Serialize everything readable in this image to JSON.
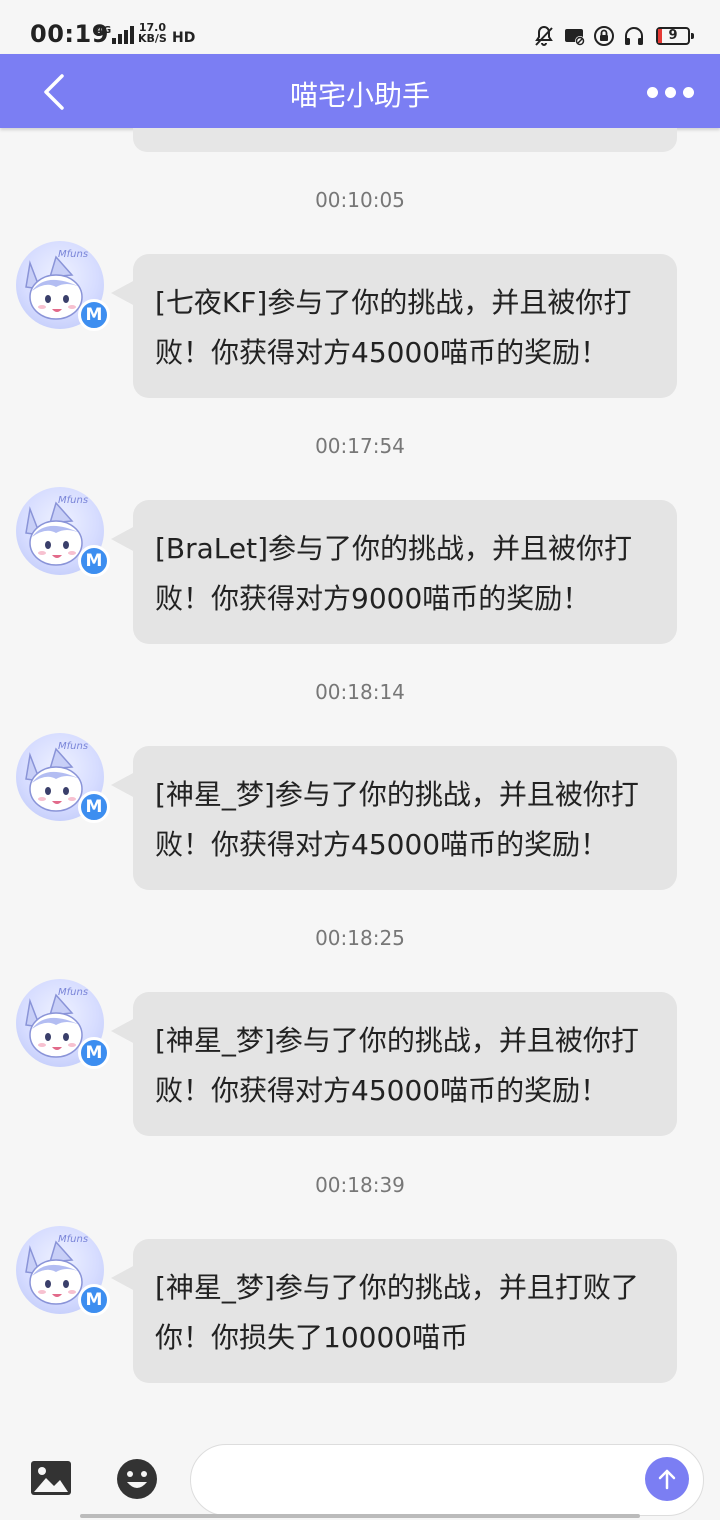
{
  "status_bar": {
    "time": "00:19",
    "network": "4G",
    "speed_value": "17.0",
    "speed_unit": "KB/S",
    "hd": "HD",
    "battery_level": "9",
    "icons": [
      "mute-icon",
      "cast-icon",
      "vpn-lock-icon",
      "headphones-icon"
    ]
  },
  "header": {
    "title": "喵宅小助手",
    "back_icon": "chevron-left-icon",
    "more_icon": "more-dots-icon"
  },
  "messages": [
    {
      "time": "00:10:05",
      "text": "[七夜KF]参与了你的挑战，并且被你打败！你获得对方45000喵币的奖励！"
    },
    {
      "time": "00:17:54",
      "text": "[BraLet]参与了你的挑战，并且被你打败！你获得对方9000喵币的奖励！"
    },
    {
      "time": "00:18:14",
      "text": "[神星_梦]参与了你的挑战，并且被你打败！你获得对方45000喵币的奖励！"
    },
    {
      "time": "00:18:25",
      "text": "[神星_梦]参与了你的挑战，并且被你打败！你获得对方45000喵币的奖励！"
    },
    {
      "time": "00:18:39",
      "text": "[神星_梦]参与了你的挑战，并且打败了你！你损失了10000喵币"
    }
  ],
  "avatar": {
    "badge": "M",
    "label": "Mfuns"
  },
  "input": {
    "placeholder": "",
    "value": ""
  },
  "colors": {
    "accent": "#7b7ef3",
    "bubble": "#e4e4e4",
    "badge": "#3d8ef0"
  }
}
